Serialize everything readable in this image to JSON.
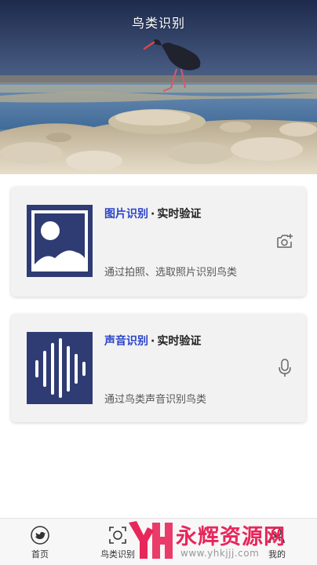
{
  "header": {
    "title": "鸟类识别"
  },
  "cards": {
    "image": {
      "title_accent": "图片识别",
      "title_separator": "·",
      "title_rest": "实时验证",
      "description": "通过拍照、选取照片识别鸟类",
      "action_icon": "camera-add-icon",
      "thumb_icon": "image-icon"
    },
    "sound": {
      "title_accent": "声音识别",
      "title_separator": "·",
      "title_rest": "实时验证",
      "description": "通过鸟类声音识别鸟类",
      "action_icon": "microphone-icon",
      "thumb_icon": "sound-wave-icon"
    }
  },
  "tabbar": {
    "items": [
      {
        "label": "首页",
        "icon": "twitter-bird-icon",
        "active": false
      },
      {
        "label": "鸟类识别",
        "icon": "scan-icon",
        "active": true
      },
      {
        "label": "我的",
        "icon": "profile-icon",
        "active": false
      }
    ]
  },
  "watermark": {
    "text": "永辉资源网",
    "url": "www.yhkjjj.com"
  },
  "colors": {
    "accent": "#2b44c8",
    "thumb_bg": "#2f3b73",
    "card_bg": "#f2f2f2",
    "watermark": "#e8265a"
  }
}
